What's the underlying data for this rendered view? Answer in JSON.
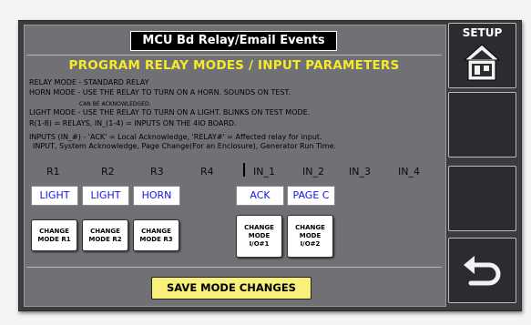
{
  "title": "MCU Bd Relay/Email Events",
  "heading": "PROGRAM RELAY MODES / INPUT PARAMETERS",
  "info": [
    "RELAY MODE - STANDARD RELAY",
    "HORN MODE - USE THE RELAY TO TURN ON A HORN.  SOUNDS ON TEST.",
    "CAN BE ACKNOWLEDGED.",
    "LIGHT MODE - USE THE RELAY TO TURN ON A LIGHT.  BLINKS ON TEST MODE.",
    "R(1-8) = RELAYS,  IN_(1-4) = INPUTS ON THE 4IO BOARD.",
    "INPUTS (IN_#) - 'ACK' = Local Acknowledge, 'RELAY#' = Affected relay for input.",
    "INPUT, System Acknowledge, Page Change(For an Enclosure), Generator Run Time."
  ],
  "columns": [
    "R1",
    "R2",
    "R3",
    "R4",
    "IN_1",
    "IN_2",
    "IN_3",
    "IN_4"
  ],
  "modes": [
    "LIGHT",
    "LIGHT",
    "HORN",
    "ACK",
    "PAGE C"
  ],
  "change_buttons": [
    "CHANGE\nMODE R1",
    "CHANGE\nMODE R2",
    "CHANGE\nMODE R3",
    "CHANGE\nMODE\nI/O#1",
    "CHANGE\nMODE\nI/O#2"
  ],
  "save_label": "SAVE MODE CHANGES",
  "side": {
    "setup_label": "SETUP",
    "setup_icon": "house-icon",
    "back_icon": "back-arrow-icon"
  },
  "colors": {
    "heading": "#f6ea2a",
    "mode_text": "#1414e0",
    "save_bg": "#f8f07a",
    "panel_bg": "#6f7175",
    "side_bg": "#2a2c30"
  }
}
